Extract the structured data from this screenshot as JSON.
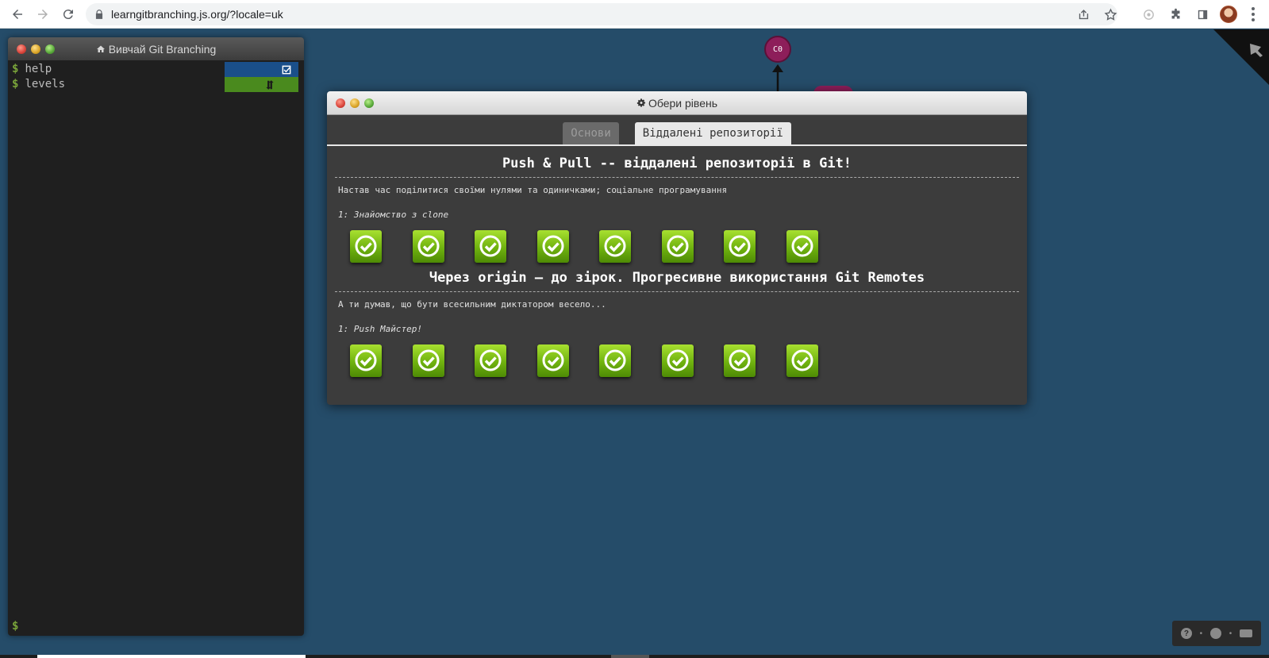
{
  "browser": {
    "url_host": "learngitbranching.js.org",
    "url_path": "/?locale=uk"
  },
  "terminal": {
    "title": "Вивчай Git Branching",
    "commands": [
      {
        "prompt": "$",
        "text": "help"
      },
      {
        "prompt": "$",
        "text": "levels"
      }
    ],
    "input_prompt": "$"
  },
  "graph": {
    "commit_label": "C0",
    "commit_color": "#8d1e5a"
  },
  "dialog": {
    "title": "Обери рівень",
    "tabs": [
      {
        "label": "Основи",
        "active": false
      },
      {
        "label": "Віддалені репозиторії",
        "active": true
      }
    ],
    "sequences": [
      {
        "title": "Push & Pull -- віддалені репозиторії в Git!",
        "description": "Настав час поділитися своїми нулями та одиничками; соціальне програмування",
        "current_level": "1: Знайомство з clone",
        "level_count": 8,
        "completed": 8
      },
      {
        "title": "Через origin – до зірок. Прогресивне використання Git Remotes",
        "description": "А ти думав, що бути всесильним диктатором весело...",
        "current_level": "1: Push Майстер!",
        "level_count": 8,
        "completed": 8
      }
    ]
  },
  "colors": {
    "background": "#254c69",
    "level_complete": "#6fb20f"
  }
}
